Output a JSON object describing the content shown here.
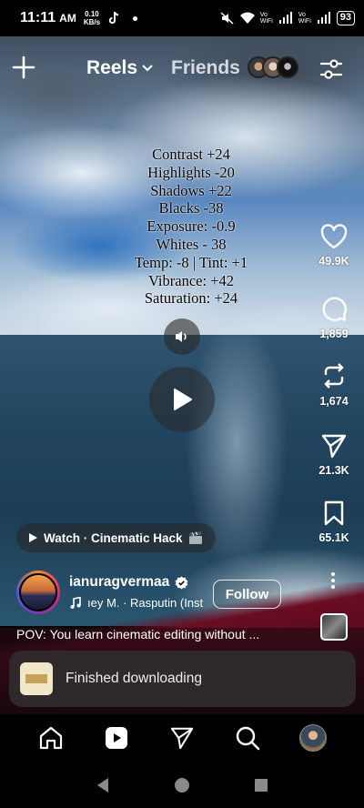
{
  "status_bar": {
    "time": "11:11",
    "ampm": "AM",
    "speed_value": "0.10",
    "speed_unit": "KB/s",
    "wifi_label_1": "Vo\nWiFi",
    "wifi_label_2": "Vo\nWiFi",
    "battery": "93"
  },
  "header": {
    "tab_reels": "Reels",
    "tab_friends": "Friends"
  },
  "video_overlay": {
    "lines": [
      "Contrast +24",
      "Highlights -20",
      "Shadows +22",
      "Blacks -38",
      "Exposure: -0.9",
      "Whites - 38",
      "Temp: -8 | Tint: +1",
      "Vibrance: +42",
      "Saturation: +24"
    ]
  },
  "actions": {
    "likes": "49.9K",
    "comments": "1,859",
    "reposts": "1,674",
    "shares": "21.3K",
    "saves": "65.1K"
  },
  "watch_pill": {
    "label": "Watch · Cinematic Hack"
  },
  "author": {
    "username": "ianuragvermaa",
    "audio": "ıey M. · Rasputin (Inst",
    "follow_label": "Follow"
  },
  "caption": "POV: You learn cinematic editing without ...",
  "toast": {
    "message": "Finished downloading"
  },
  "colors": {
    "accent_story_ring": "#dd2a7b",
    "verified": "#ffffff",
    "toast_bg": "#302a2e"
  },
  "icons": {
    "header_left": "plus-icon",
    "header_right": "filter-icon",
    "sound": "speaker-icon",
    "play": "play-icon",
    "like": "heart-icon",
    "comment": "comment-icon",
    "repost": "repost-icon",
    "share": "send-icon",
    "save": "bookmark-icon",
    "nav": [
      "home-icon",
      "reels-icon",
      "send-icon",
      "search-icon",
      "profile-avatar"
    ]
  }
}
